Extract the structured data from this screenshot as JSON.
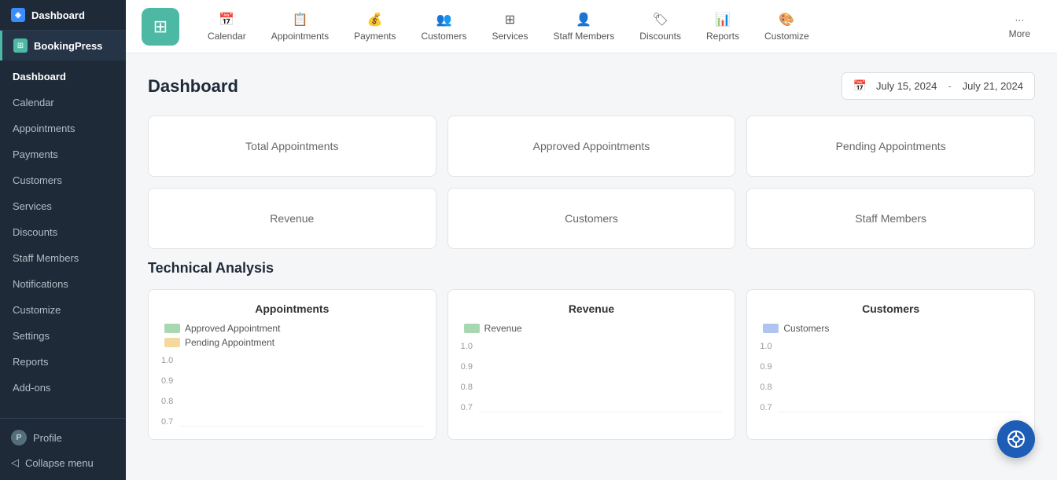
{
  "sidebar": {
    "app_label": "Dashboard",
    "brand_label": "BookingPress",
    "nav_items": [
      {
        "label": "Dashboard",
        "active": true
      },
      {
        "label": "Calendar",
        "active": false
      },
      {
        "label": "Appointments",
        "active": false
      },
      {
        "label": "Payments",
        "active": false
      },
      {
        "label": "Customers",
        "active": false
      },
      {
        "label": "Services",
        "active": false
      },
      {
        "label": "Discounts",
        "active": false
      },
      {
        "label": "Staff Members",
        "active": false
      },
      {
        "label": "Notifications",
        "active": false
      },
      {
        "label": "Customize",
        "active": false
      },
      {
        "label": "Settings",
        "active": false
      },
      {
        "label": "Reports",
        "active": false
      },
      {
        "label": "Add-ons",
        "active": false
      }
    ],
    "profile_label": "Profile",
    "collapse_label": "Collapse menu"
  },
  "topnav": {
    "logo_symbol": "⊞",
    "items": [
      {
        "label": "Calendar",
        "icon": "📅"
      },
      {
        "label": "Appointments",
        "icon": "📋"
      },
      {
        "label": "Payments",
        "icon": "💰"
      },
      {
        "label": "Customers",
        "icon": "👥"
      },
      {
        "label": "Services",
        "icon": "⊞"
      },
      {
        "label": "Staff Members",
        "icon": "👤"
      },
      {
        "label": "Discounts",
        "icon": "🏷"
      },
      {
        "label": "Reports",
        "icon": "📊"
      },
      {
        "label": "Customize",
        "icon": "🎨"
      }
    ],
    "more_label": "More",
    "more_icon": "···"
  },
  "dashboard": {
    "title": "Dashboard",
    "date_start": "July 15, 2024",
    "date_end": "July 21, 2024",
    "date_separator": "-",
    "stat_cards": [
      {
        "label": "Total Appointments"
      },
      {
        "label": "Approved Appointments"
      },
      {
        "label": "Pending Appointments"
      },
      {
        "label": "Revenue"
      },
      {
        "label": "Customers"
      },
      {
        "label": "Staff Members"
      }
    ],
    "analysis_title": "Technical Analysis",
    "analysis_cards": [
      {
        "title": "Appointments",
        "legends": [
          {
            "label": "Approved Appointment",
            "color": "#a8d8b0"
          },
          {
            "label": "Pending Appointment",
            "color": "#f5d89e"
          }
        ]
      },
      {
        "title": "Revenue",
        "legends": [
          {
            "label": "Revenue",
            "color": "#a8d8b0"
          }
        ]
      },
      {
        "title": "Customers",
        "legends": [
          {
            "label": "Customers",
            "color": "#b0c4f0"
          }
        ]
      }
    ],
    "y_axis_labels": [
      "1.0",
      "0.9",
      "0.8",
      "0.7"
    ]
  },
  "fab": {
    "icon": "⊗",
    "label": "help"
  }
}
